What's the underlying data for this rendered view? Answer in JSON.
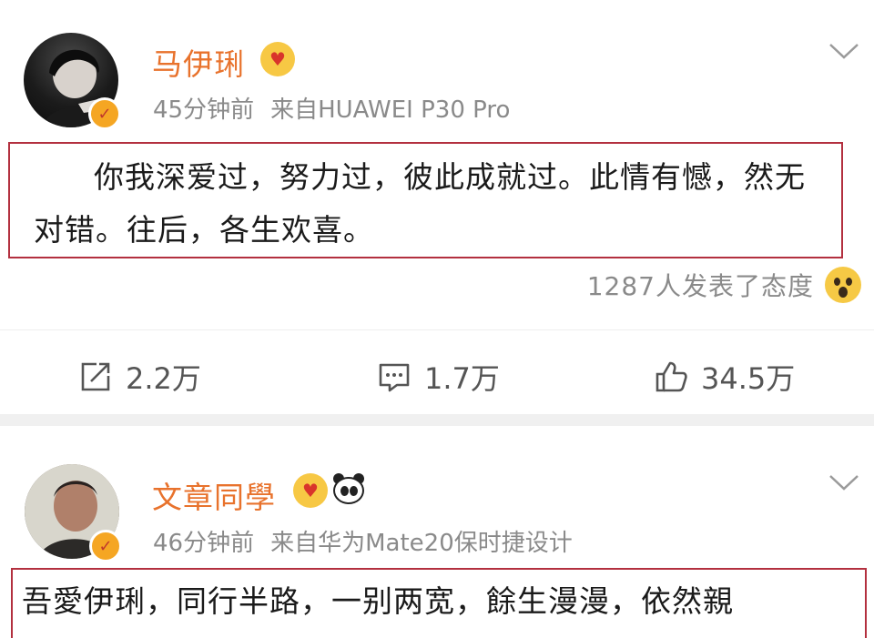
{
  "posts": [
    {
      "username": "马伊琍",
      "time": "45分钟前",
      "source": "来自HUAWEI P30 Pro",
      "content": "你我深爱过，努力过，彼此成就过。此情有憾，然无对错。往后，各生欢喜。",
      "reactions": "1287人发表了态度",
      "actions": {
        "share": "2.2万",
        "comment": "1.7万",
        "like": "34.5万"
      }
    },
    {
      "username": "文章同學",
      "time": "46分钟前",
      "source": "来自华为Mate20保时捷设计",
      "content": "吾愛伊琍，同行半路，一别两宽，餘生漫漫，依然親"
    }
  ],
  "colors": {
    "username": "#e8722c",
    "highlight_border": "#b3303f",
    "meta": "#8a8a8a",
    "verified": "#f5a623"
  },
  "icons": [
    "verified-badge-icon",
    "vip-heart-icon",
    "panda-emoji-icon",
    "chevron-down-icon",
    "surprised-emoji-icon",
    "share-icon",
    "comment-icon",
    "like-icon"
  ]
}
